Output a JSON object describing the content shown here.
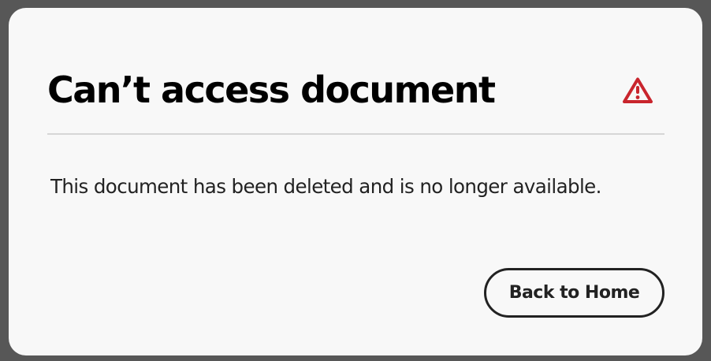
{
  "dialog": {
    "title": "Can’t access document",
    "icon": "alert-triangle-icon",
    "message": "This document has been deleted and is no longer available.",
    "back_button_label": "Back to Home"
  },
  "colors": {
    "overlay": "#575757",
    "dialog_background": "#f8f8f8",
    "alert_red": "#c9252d",
    "text": "#222222"
  }
}
